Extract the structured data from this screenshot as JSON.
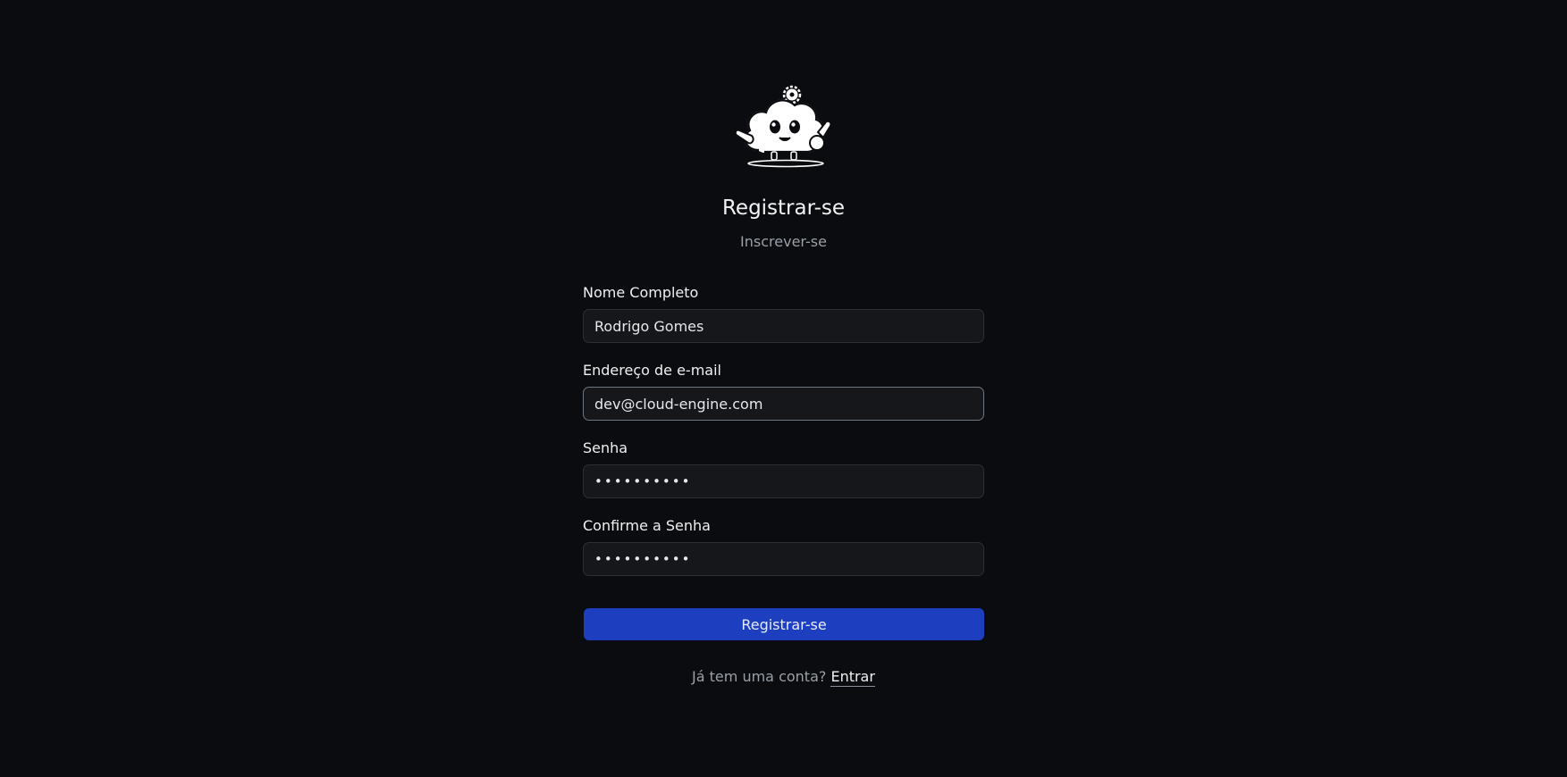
{
  "header": {
    "mascot_icon": "cloud-mascot-logo",
    "title": "Registrar-se",
    "subtitle": "Inscrever-se"
  },
  "form": {
    "full_name": {
      "label": "Nome Completo",
      "value": "Rodrigo Gomes"
    },
    "email": {
      "label": "Endereço de e-mail",
      "value": "dev@cloud-engine.com"
    },
    "password": {
      "label": "Senha",
      "value": "••••••••••"
    },
    "confirm_password": {
      "label": "Confirme a Senha",
      "value": "••••••••••"
    },
    "submit_label": "Registrar-se"
  },
  "footer": {
    "prompt": "Já tem uma conta?",
    "signin_link": "Entrar"
  },
  "colors": {
    "background": "#0a0c0f",
    "input_bg": "#15171b",
    "primary_button": "#1c3ebf"
  }
}
